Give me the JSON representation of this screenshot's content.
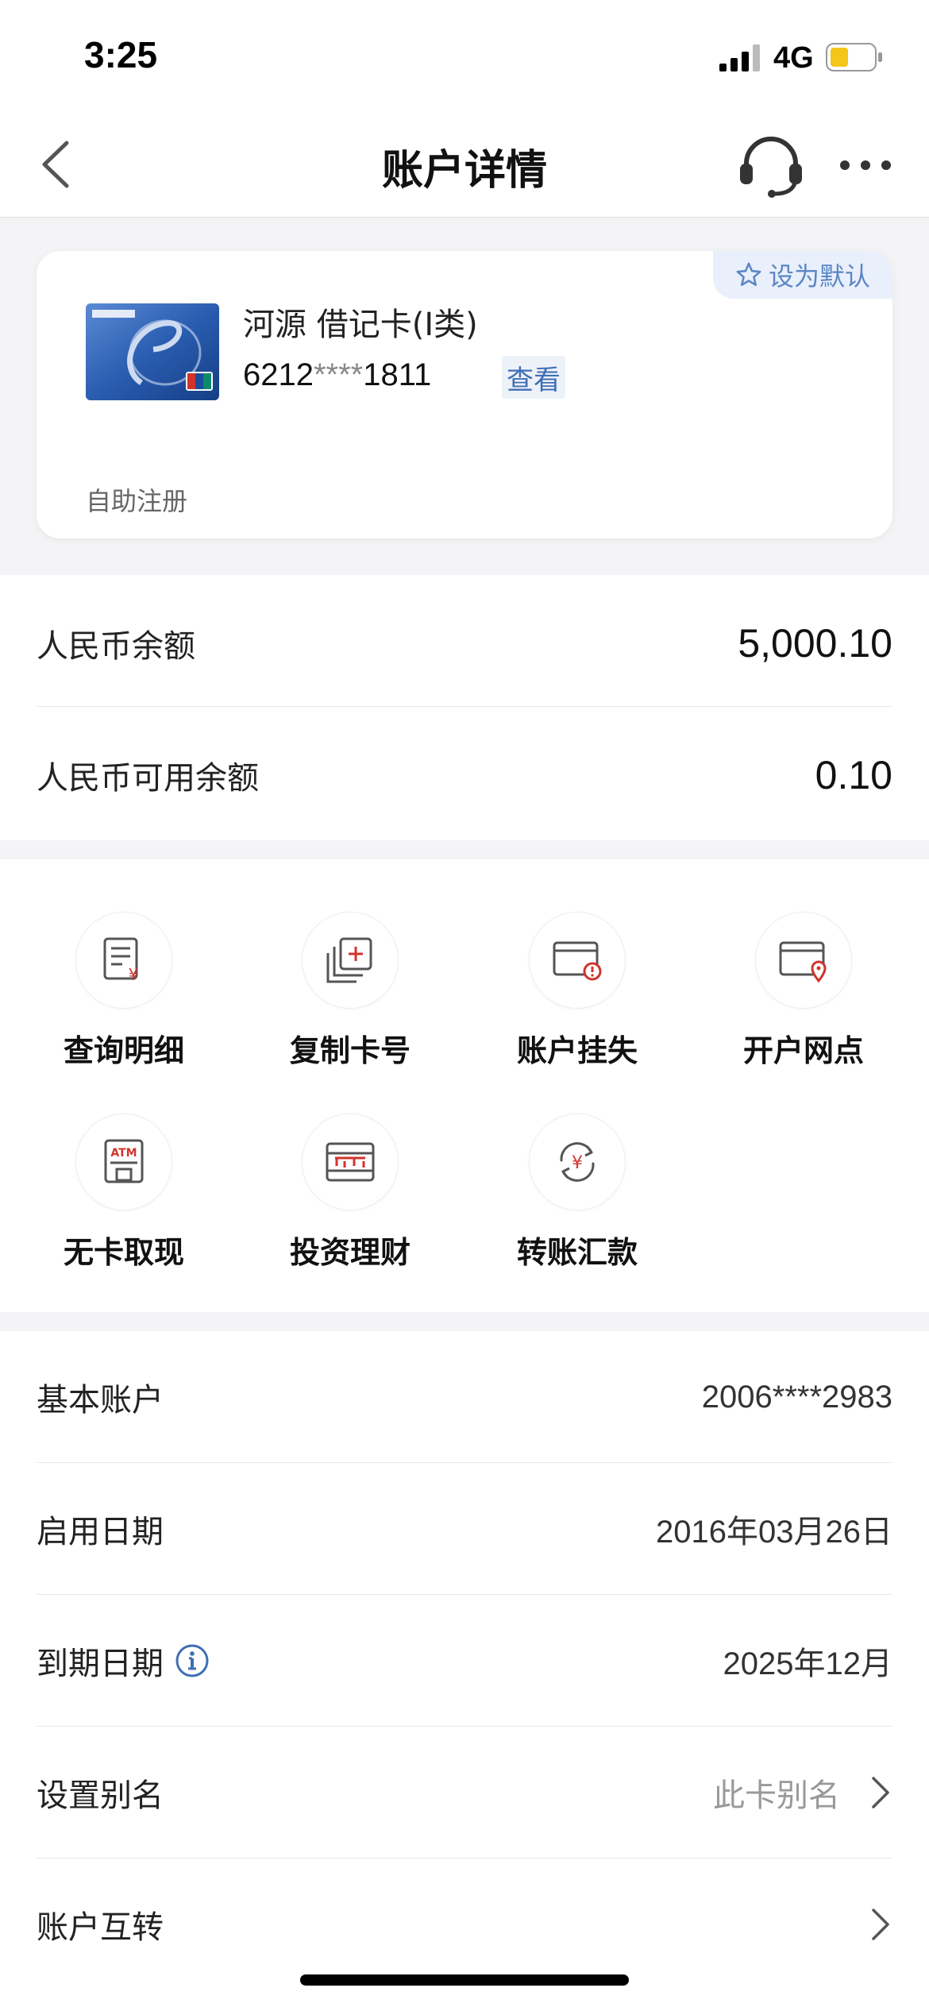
{
  "status_bar": {
    "time": "3:25",
    "network": "4G",
    "battery_color": "#f5c518"
  },
  "nav": {
    "title": "账户详情"
  },
  "card": {
    "default_label": "设为默认",
    "name": "河源 借记卡(Ⅰ类)",
    "number_prefix": "6212",
    "number_mask": "****",
    "number_suffix": "1811",
    "view_label": "查看",
    "registration": "自助注册"
  },
  "balances": [
    {
      "label": "人民币余额",
      "value": "5,000.10"
    },
    {
      "label": "人民币可用余额",
      "value": "0.10"
    }
  ],
  "functions": [
    {
      "label": "查询明细",
      "icon": "detail-query-icon"
    },
    {
      "label": "复制卡号",
      "icon": "copy-card-icon"
    },
    {
      "label": "账户挂失",
      "icon": "report-loss-icon"
    },
    {
      "label": "开户网点",
      "icon": "branch-location-icon"
    },
    {
      "label": "无卡取现",
      "icon": "atm-icon"
    },
    {
      "label": "投资理财",
      "icon": "investment-icon"
    },
    {
      "label": "转账汇款",
      "icon": "transfer-icon"
    }
  ],
  "info": {
    "basic_account": {
      "label": "基本账户",
      "value": "2006****2983"
    },
    "start_date": {
      "label": "启用日期",
      "value": "2016年03月26日"
    },
    "expiry_date": {
      "label": "到期日期",
      "value": "2025年12月"
    },
    "alias": {
      "label": "设置别名",
      "value": "此卡别名"
    },
    "transfer": {
      "label": "账户互转"
    }
  },
  "colors": {
    "accent_blue": "#3e6fb5",
    "icon_red": "#d0342c"
  }
}
